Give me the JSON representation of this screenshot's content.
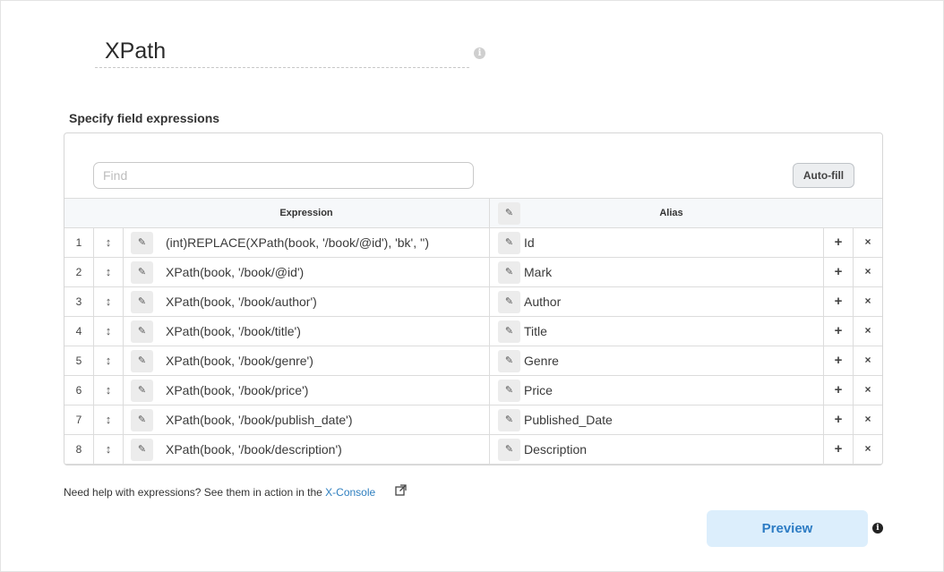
{
  "title": "XPath",
  "section_label": "Specify field expressions",
  "find": {
    "placeholder": "Find",
    "value": ""
  },
  "autofill_label": "Auto-fill",
  "columns": {
    "expression": "Expression",
    "alias": "Alias"
  },
  "rows": [
    {
      "num": "1",
      "expression": "(int)REPLACE(XPath(book, '/book/@id'), 'bk', '')",
      "alias": "Id"
    },
    {
      "num": "2",
      "expression": "XPath(book, '/book/@id')",
      "alias": "Mark"
    },
    {
      "num": "3",
      "expression": "XPath(book, '/book/author')",
      "alias": "Author"
    },
    {
      "num": "4",
      "expression": "XPath(book, '/book/title')",
      "alias": "Title"
    },
    {
      "num": "5",
      "expression": "XPath(book, '/book/genre')",
      "alias": "Genre"
    },
    {
      "num": "6",
      "expression": "XPath(book, '/book/price')",
      "alias": "Price"
    },
    {
      "num": "7",
      "expression": "XPath(book, '/book/publish_date')",
      "alias": "Published_Date"
    },
    {
      "num": "8",
      "expression": "XPath(book, '/book/description')",
      "alias": "Description"
    }
  ],
  "row_icons": {
    "drag": "↕",
    "edit": "✎",
    "alias": "✎",
    "add": "+",
    "remove": "×"
  },
  "help": {
    "text": "Need help with expressions? See them in action in the ",
    "link": "X-Console"
  },
  "preview_label": "Preview",
  "colors": {
    "accent": "#2d7cc4",
    "preview_bg": "#dceefc",
    "link": "#2f7fbf"
  }
}
